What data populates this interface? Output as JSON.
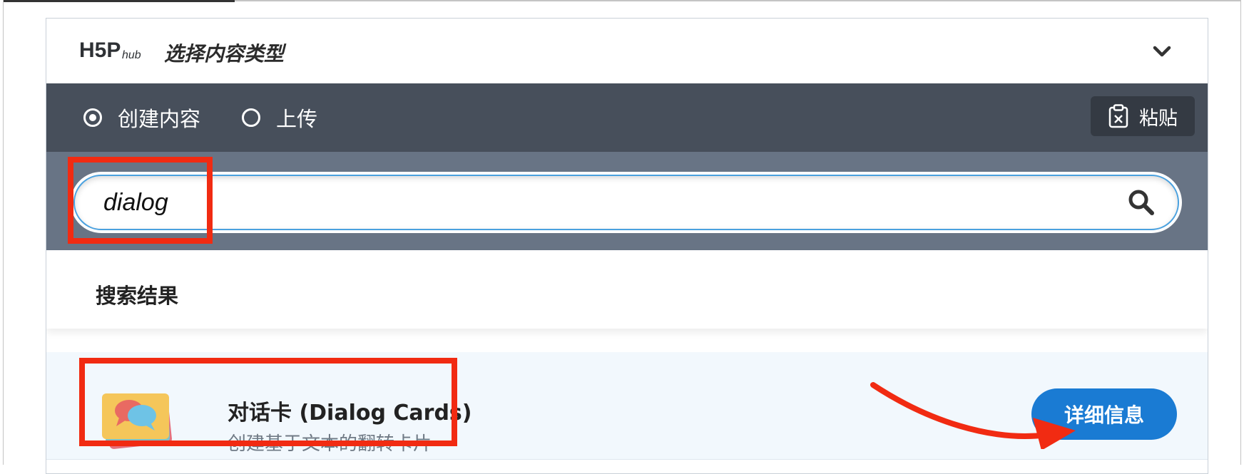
{
  "header": {
    "logo_text": "H5P hub",
    "title": "选择内容类型",
    "collapse_icon": "chevron-down-icon"
  },
  "tabs": {
    "create_label": "创建内容",
    "upload_label": "上传",
    "selected": "create",
    "paste_label": "粘贴",
    "paste_icon": "clipboard-icon"
  },
  "search": {
    "value": "dialog",
    "icon": "search-icon"
  },
  "results": {
    "heading": "搜索结果",
    "items": [
      {
        "title": "对话卡 (Dialog Cards)",
        "description": "创建基于文本的翻转卡片",
        "details_label": "详细信息",
        "icon": "dialog-cards-icon"
      }
    ]
  },
  "colors": {
    "tabs_bg": "#474f5b",
    "search_bg": "#687485",
    "accent": "#1a7bd3",
    "annotation": "#f12b12"
  }
}
